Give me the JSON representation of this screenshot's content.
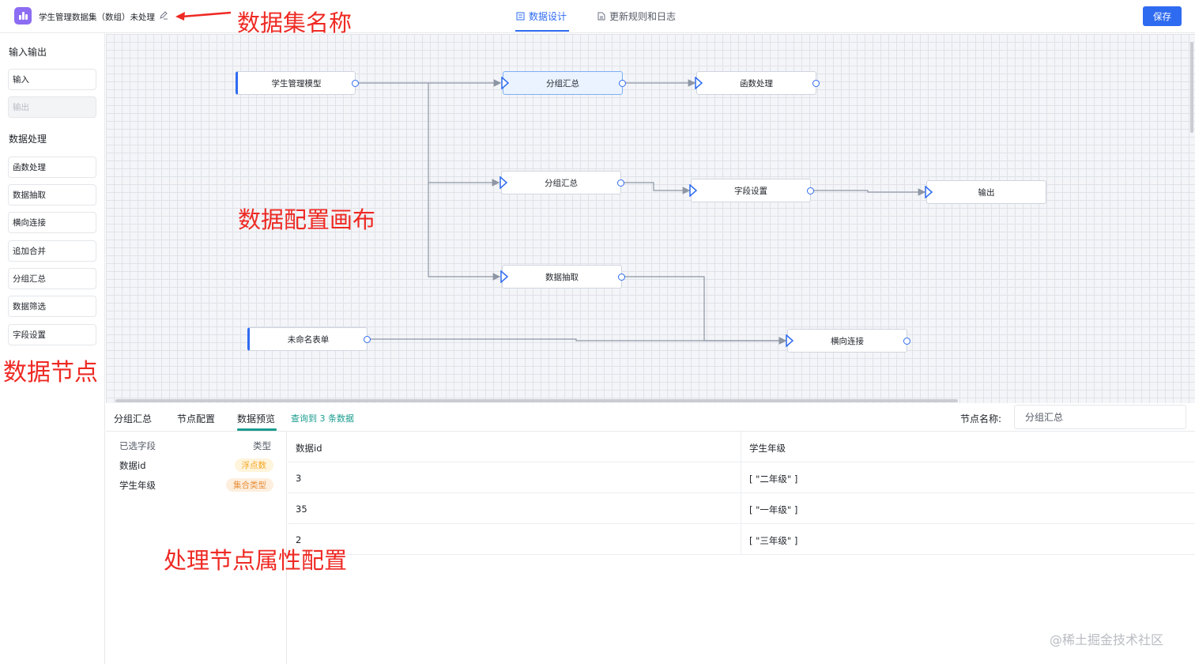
{
  "header": {
    "dataset_title": "学生管理数据集（数组）未处理",
    "tabs": [
      {
        "label": "数据设计",
        "active": true
      },
      {
        "label": "更新规则和日志",
        "active": false
      }
    ],
    "save_label": "保存",
    "accent_color": "#2f6bf0"
  },
  "sidebar": {
    "sections": [
      {
        "title": "输入输出",
        "items": [
          {
            "label": "输入",
            "disabled": false
          },
          {
            "label": "输出",
            "disabled": true
          }
        ]
      },
      {
        "title": "数据处理",
        "items": [
          {
            "label": "函数处理"
          },
          {
            "label": "数据抽取"
          },
          {
            "label": "横向连接"
          },
          {
            "label": "追加合并"
          },
          {
            "label": "分组汇总"
          },
          {
            "label": "数据筛选"
          },
          {
            "label": "字段设置"
          }
        ]
      }
    ]
  },
  "canvas": {
    "nodes": [
      {
        "id": "n1",
        "label": "学生管理模型"
      },
      {
        "id": "n2",
        "label": "分组汇总",
        "selected": true
      },
      {
        "id": "n3",
        "label": "函数处理"
      },
      {
        "id": "n4",
        "label": "分组汇总"
      },
      {
        "id": "n5",
        "label": "字段设置"
      },
      {
        "id": "n6",
        "label": "输出"
      },
      {
        "id": "n7",
        "label": "数据抽取"
      },
      {
        "id": "n8",
        "label": "未命名表单"
      },
      {
        "id": "n9",
        "label": "横向连接"
      }
    ]
  },
  "annotations": {
    "dataset_name": "数据集名称",
    "canvas": "数据配置画布",
    "nodes": "数据节点",
    "props": "处理节点属性配置",
    "color": "#ee2a24"
  },
  "bottom": {
    "tabs": [
      "分组汇总",
      "节点配置",
      "数据预览"
    ],
    "active_tab": "数据预览",
    "query_result": "查询到 3 条数据",
    "node_name_label": "节点名称:",
    "node_name_value": "分组汇总",
    "fields_header": {
      "selected": "已选字段",
      "type": "类型"
    },
    "fields": [
      {
        "name": "数据id",
        "type": "浮点数",
        "color": "#f5a623",
        "bg": "#fff4dc"
      },
      {
        "name": "学生年级",
        "type": "集合类型",
        "color": "#e8903a",
        "bg": "#fdeede"
      }
    ],
    "table": {
      "columns": [
        "数据id",
        "学生年级"
      ],
      "rows": [
        [
          "3",
          "[ \"二年级\" ]"
        ],
        [
          "35",
          "[ \"一年级\" ]"
        ],
        [
          "2",
          "[ \"三年级\" ]"
        ]
      ]
    }
  },
  "watermark": "@稀土掘金技术社区"
}
